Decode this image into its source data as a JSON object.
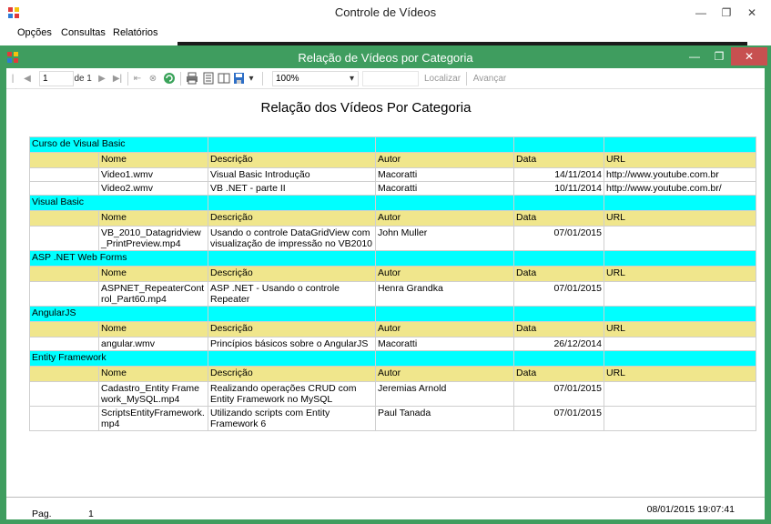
{
  "window": {
    "title": "Controle de Vídeos",
    "minimize": "—",
    "restore": "❐",
    "close": "✕"
  },
  "menu": [
    "Opções",
    "Consultas",
    "Relatórios"
  ],
  "child_window": {
    "title": "Relação de Vídeos por Categoria",
    "minimize": "—",
    "restore": "❐",
    "close": "✕"
  },
  "toolbar": {
    "page_current": "1",
    "page_of": "de",
    "page_total": "1",
    "zoom": "100%",
    "search_placeholder": "",
    "find_label": "Localizar",
    "next_label": "Avançar"
  },
  "report": {
    "title": "Relação dos Vídeos Por Categoria",
    "columns": [
      "Nome",
      "Descrição",
      "Autor",
      "Data",
      "URL"
    ],
    "categories": [
      {
        "name": "Curso de Visual Basic",
        "rows": [
          [
            "Video1.wmv",
            "Visual Basic Introdução",
            "Macoratti",
            "14/11/2014",
            "http://www.youtube.com.br"
          ],
          [
            "Video2.wmv",
            "VB .NET - parte II",
            "Macoratti",
            "10/11/2014",
            "http://www.youtube.com.br/"
          ]
        ]
      },
      {
        "name": "Visual Basic",
        "rows": [
          [
            "VB_2010_Datagridview_PrintPreview.mp4",
            "Usando o controle DataGridView com visualização de impressão no VB2010",
            "John Muller",
            "07/01/2015",
            ""
          ]
        ]
      },
      {
        "name": "ASP .NET Web Forms",
        "rows": [
          [
            "ASPNET_RepeaterControl_Part60.mp4",
            "ASP .NET - Usando o controle Repeater",
            "Henra Grandka",
            "07/01/2015",
            ""
          ]
        ]
      },
      {
        "name": "AngularJS",
        "rows": [
          [
            "angular.wmv",
            "Princípios básicos sobre o AngularJS",
            "Macoratti",
            "26/12/2014",
            ""
          ]
        ]
      },
      {
        "name": "Entity Framework",
        "rows": [
          [
            "Cadastro_Entity Framework_MySQL.mp4",
            "Realizando operações CRUD com Entity Framework no MySQL",
            "Jeremias Arnold",
            "07/01/2015",
            ""
          ],
          [
            "ScriptsEntityFramework.mp4",
            "Utilizando scripts com Entity Framework 6",
            "Paul Tanada",
            "07/01/2015",
            ""
          ]
        ]
      }
    ],
    "footer": {
      "page_label": "Pag.",
      "page_number": "1",
      "printed_at": "08/01/2015 19:07:41"
    }
  }
}
